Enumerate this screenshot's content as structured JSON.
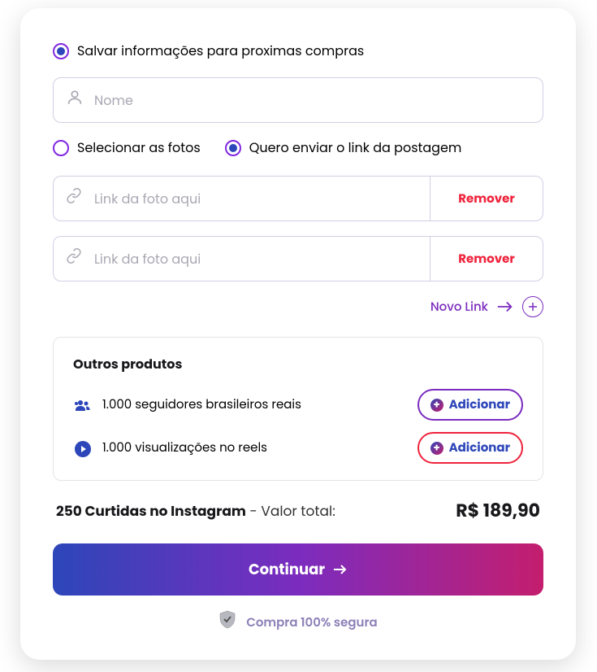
{
  "saveInfo": {
    "label": "Salvar informações para proximas compras"
  },
  "nameInput": {
    "placeholder": "Nome"
  },
  "photoMethod": {
    "selectPhotos": "Selecionar as fotos",
    "sendLink": "Quero enviar o link da postagem"
  },
  "linkInputs": [
    {
      "placeholder": "Link da foto aqui",
      "removeLabel": "Remover"
    },
    {
      "placeholder": "Link da foto aqui",
      "removeLabel": "Remover"
    }
  ],
  "newLink": {
    "label": "Novo Link"
  },
  "products": {
    "title": "Outros produtos",
    "items": [
      {
        "text": "1.000 seguidores brasileiros reais",
        "addLabel": "Adicionar"
      },
      {
        "text": "1.000 visualizações no reels",
        "addLabel": "Adicionar"
      }
    ]
  },
  "summary": {
    "productName": "250 Curtidas no Instagram",
    "totalLabel": " - Valor total:",
    "price": "R$ 189,90"
  },
  "continueBtn": "Continuar",
  "securePurchase": "Compra 100% segura"
}
